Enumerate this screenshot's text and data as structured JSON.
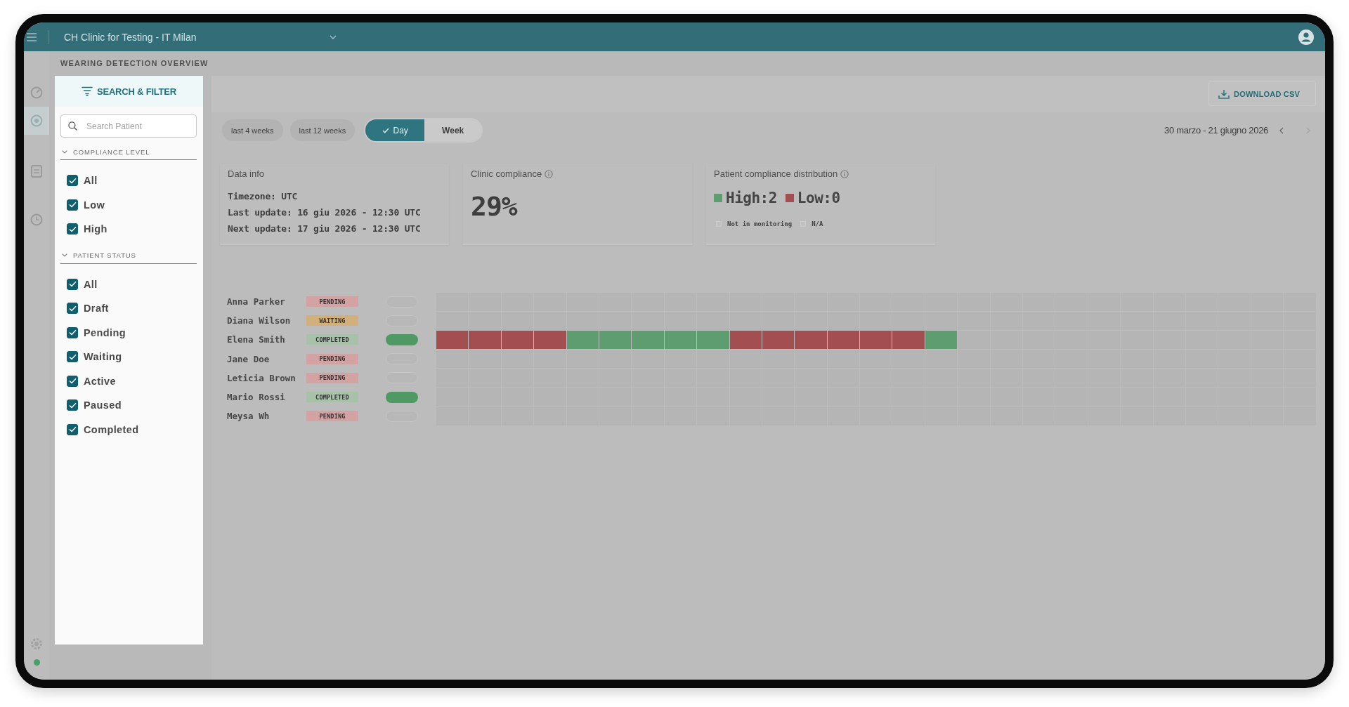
{
  "top_bar": {
    "title": "CH Clinic for Testing - IT Milan"
  },
  "nav_rail": [
    {
      "kind": "gauge",
      "selected": false
    },
    {
      "kind": "target",
      "selected": true
    },
    {
      "kind": "document",
      "selected": false
    },
    {
      "kind": "clock",
      "selected": false
    }
  ],
  "page_title": "WEARING DETECTION OVERVIEW",
  "filter_panel": {
    "title": "SEARCH & FILTER",
    "search": {
      "placeholder": "Search Patient"
    },
    "sections": [
      {
        "title": "COMPLIANCE LEVEL",
        "expanded": true,
        "options": [
          {
            "label": "All",
            "checked": true
          },
          {
            "label": "Low",
            "checked": true
          },
          {
            "label": "High",
            "checked": true
          }
        ]
      },
      {
        "title": "PATIENT STATUS",
        "expanded": true,
        "options": [
          {
            "label": "All",
            "checked": true
          },
          {
            "label": "Draft",
            "checked": true
          },
          {
            "label": "Pending",
            "checked": true
          },
          {
            "label": "Waiting",
            "checked": true
          },
          {
            "label": "Active",
            "checked": true
          },
          {
            "label": "Paused",
            "checked": true
          },
          {
            "label": "Completed",
            "checked": true
          }
        ]
      }
    ]
  },
  "download_button": "DOWNLOAD CSV",
  "range_presets": [
    {
      "label": "last 4 weeks",
      "selected": false
    },
    {
      "label": "last 12 weeks",
      "selected": false
    }
  ],
  "view_toggle": [
    {
      "label": "Day",
      "selected": true
    },
    {
      "label": "Week",
      "selected": false
    }
  ],
  "date_range": {
    "label": "30 marzo - 21 giugno 2026",
    "previous": {
      "disabled": false
    },
    "next": {
      "disabled": true
    }
  },
  "data_info": {
    "title": "Data info",
    "lines": [
      "Timezone: UTC",
      "Last update: 16 giu 2026 - 12:30 UTC",
      "Next update: 17 giu 2026 - 12:30 UTC"
    ]
  },
  "clinic_compliance": {
    "title": "Clinic compliance",
    "value": "29%"
  },
  "distribution": {
    "title": "Patient compliance distribution",
    "items": [
      {
        "label": "High:2",
        "color": "#5e9d6f"
      },
      {
        "label": "Low:0",
        "color": "#a34f52"
      }
    ],
    "legend": [
      "Not in monitoring",
      "N/A"
    ]
  },
  "patients": [
    {
      "name": "Anna Parker",
      "status": {
        "label": "PENDING",
        "color": "#d3a2a2"
      },
      "average": {
        "kind": "none"
      },
      "days": [
        {
          "kind": "none"
        },
        {
          "kind": "none"
        },
        {
          "kind": "none"
        },
        {
          "kind": "none"
        },
        {
          "kind": "none"
        },
        {
          "kind": "none"
        },
        {
          "kind": "none"
        },
        {
          "kind": "none"
        },
        {
          "kind": "none"
        },
        {
          "kind": "none"
        },
        {
          "kind": "none"
        },
        {
          "kind": "none"
        },
        {
          "kind": "none"
        },
        {
          "kind": "none"
        },
        {
          "kind": "none"
        },
        {
          "kind": "none"
        },
        {
          "kind": "none"
        },
        {
          "kind": "none"
        },
        {
          "kind": "none"
        },
        {
          "kind": "none"
        },
        {
          "kind": "none"
        },
        {
          "kind": "none"
        },
        {
          "kind": "none"
        },
        {
          "kind": "none"
        },
        {
          "kind": "none"
        },
        {
          "kind": "none"
        },
        {
          "kind": "none"
        }
      ]
    },
    {
      "name": "Diana Wilson",
      "status": {
        "label": "WAITING",
        "color": "#d2b07c"
      },
      "average": {
        "kind": "none"
      },
      "days": [
        {
          "kind": "none"
        },
        {
          "kind": "none"
        },
        {
          "kind": "none"
        },
        {
          "kind": "none"
        },
        {
          "kind": "none"
        },
        {
          "kind": "none"
        },
        {
          "kind": "none"
        },
        {
          "kind": "none"
        },
        {
          "kind": "none"
        },
        {
          "kind": "none"
        },
        {
          "kind": "none"
        },
        {
          "kind": "none"
        },
        {
          "kind": "none"
        },
        {
          "kind": "none"
        },
        {
          "kind": "none"
        },
        {
          "kind": "none"
        },
        {
          "kind": "none"
        },
        {
          "kind": "none"
        },
        {
          "kind": "none"
        },
        {
          "kind": "none"
        },
        {
          "kind": "none"
        },
        {
          "kind": "none"
        },
        {
          "kind": "none"
        },
        {
          "kind": "none"
        },
        {
          "kind": "none"
        },
        {
          "kind": "none"
        },
        {
          "kind": "none"
        }
      ]
    },
    {
      "name": "Elena Smith",
      "status": {
        "label": "COMPLETED",
        "color": "#a8c2a9"
      },
      "average": {
        "kind": "high"
      },
      "days": [
        {
          "kind": "low"
        },
        {
          "kind": "low"
        },
        {
          "kind": "low"
        },
        {
          "kind": "low"
        },
        {
          "kind": "high"
        },
        {
          "kind": "high"
        },
        {
          "kind": "high"
        },
        {
          "kind": "high"
        },
        {
          "kind": "high"
        },
        {
          "kind": "low"
        },
        {
          "kind": "low"
        },
        {
          "kind": "low"
        },
        {
          "kind": "low"
        },
        {
          "kind": "low"
        },
        {
          "kind": "low"
        },
        {
          "kind": "high"
        },
        {
          "kind": "none"
        },
        {
          "kind": "none"
        },
        {
          "kind": "none"
        },
        {
          "kind": "none"
        },
        {
          "kind": "none"
        },
        {
          "kind": "none"
        },
        {
          "kind": "none"
        },
        {
          "kind": "none"
        },
        {
          "kind": "none"
        },
        {
          "kind": "none"
        },
        {
          "kind": "none"
        }
      ]
    },
    {
      "name": "Jane Doe",
      "status": {
        "label": "PENDING",
        "color": "#d3a2a2"
      },
      "average": {
        "kind": "none"
      },
      "days": [
        {
          "kind": "none"
        },
        {
          "kind": "none"
        },
        {
          "kind": "none"
        },
        {
          "kind": "none"
        },
        {
          "kind": "none"
        },
        {
          "kind": "none"
        },
        {
          "kind": "none"
        },
        {
          "kind": "none"
        },
        {
          "kind": "none"
        },
        {
          "kind": "none"
        },
        {
          "kind": "none"
        },
        {
          "kind": "none"
        },
        {
          "kind": "none"
        },
        {
          "kind": "none"
        },
        {
          "kind": "none"
        },
        {
          "kind": "none"
        },
        {
          "kind": "none"
        },
        {
          "kind": "none"
        },
        {
          "kind": "none"
        },
        {
          "kind": "none"
        },
        {
          "kind": "none"
        },
        {
          "kind": "none"
        },
        {
          "kind": "none"
        },
        {
          "kind": "none"
        },
        {
          "kind": "none"
        },
        {
          "kind": "none"
        },
        {
          "kind": "none"
        }
      ]
    },
    {
      "name": "Leticia Brown",
      "status": {
        "label": "PENDING",
        "color": "#d3a2a2"
      },
      "average": {
        "kind": "none"
      },
      "days": [
        {
          "kind": "none"
        },
        {
          "kind": "none"
        },
        {
          "kind": "none"
        },
        {
          "kind": "none"
        },
        {
          "kind": "none"
        },
        {
          "kind": "none"
        },
        {
          "kind": "none"
        },
        {
          "kind": "none"
        },
        {
          "kind": "none"
        },
        {
          "kind": "none"
        },
        {
          "kind": "none"
        },
        {
          "kind": "none"
        },
        {
          "kind": "none"
        },
        {
          "kind": "none"
        },
        {
          "kind": "none"
        },
        {
          "kind": "none"
        },
        {
          "kind": "none"
        },
        {
          "kind": "none"
        },
        {
          "kind": "none"
        },
        {
          "kind": "none"
        },
        {
          "kind": "none"
        },
        {
          "kind": "none"
        },
        {
          "kind": "none"
        },
        {
          "kind": "none"
        },
        {
          "kind": "none"
        },
        {
          "kind": "none"
        },
        {
          "kind": "none"
        }
      ]
    },
    {
      "name": "Mario Rossi",
      "status": {
        "label": "COMPLETED",
        "color": "#a8c2a9"
      },
      "average": {
        "kind": "high"
      },
      "days": [
        {
          "kind": "none"
        },
        {
          "kind": "none"
        },
        {
          "kind": "none"
        },
        {
          "kind": "none"
        },
        {
          "kind": "none"
        },
        {
          "kind": "none"
        },
        {
          "kind": "none"
        },
        {
          "kind": "none"
        },
        {
          "kind": "none"
        },
        {
          "kind": "none"
        },
        {
          "kind": "none"
        },
        {
          "kind": "none"
        },
        {
          "kind": "none"
        },
        {
          "kind": "none"
        },
        {
          "kind": "none"
        },
        {
          "kind": "none"
        },
        {
          "kind": "none"
        },
        {
          "kind": "none"
        },
        {
          "kind": "none"
        },
        {
          "kind": "none"
        },
        {
          "kind": "none"
        },
        {
          "kind": "none"
        },
        {
          "kind": "none"
        },
        {
          "kind": "none"
        },
        {
          "kind": "none"
        },
        {
          "kind": "none"
        },
        {
          "kind": "none"
        }
      ]
    },
    {
      "name": "Meysa Wh",
      "status": {
        "label": "PENDING",
        "color": "#d3a2a2"
      },
      "average": {
        "kind": "none"
      },
      "days": [
        {
          "kind": "none"
        },
        {
          "kind": "none"
        },
        {
          "kind": "none"
        },
        {
          "kind": "none"
        },
        {
          "kind": "none"
        },
        {
          "kind": "none"
        },
        {
          "kind": "none"
        },
        {
          "kind": "none"
        },
        {
          "kind": "none"
        },
        {
          "kind": "none"
        },
        {
          "kind": "none"
        },
        {
          "kind": "none"
        },
        {
          "kind": "none"
        },
        {
          "kind": "none"
        },
        {
          "kind": "none"
        },
        {
          "kind": "none"
        },
        {
          "kind": "none"
        },
        {
          "kind": "none"
        },
        {
          "kind": "none"
        },
        {
          "kind": "none"
        },
        {
          "kind": "none"
        },
        {
          "kind": "none"
        },
        {
          "kind": "none"
        },
        {
          "kind": "none"
        },
        {
          "kind": "none"
        },
        {
          "kind": "none"
        },
        {
          "kind": "none"
        }
      ]
    }
  ]
}
